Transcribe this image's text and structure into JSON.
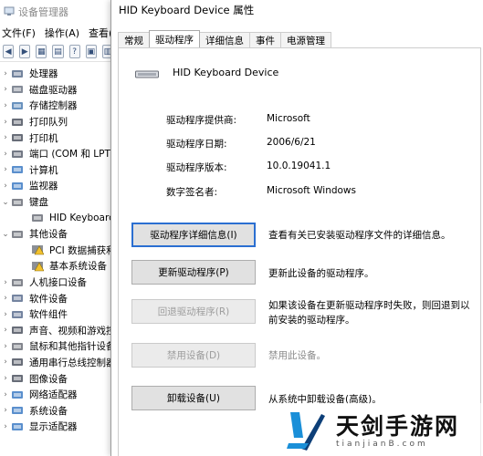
{
  "device_manager": {
    "title": "设备管理器",
    "menu": [
      "文件(F)",
      "操作(A)",
      "查看(V)"
    ],
    "tree": [
      {
        "chevron": "›",
        "icon": "cpu-icon",
        "label": "处理器"
      },
      {
        "chevron": "›",
        "icon": "disk-drive-icon",
        "label": "磁盘驱动器"
      },
      {
        "chevron": "›",
        "icon": "storage-controller-icon",
        "label": "存储控制器"
      },
      {
        "chevron": "›",
        "icon": "printer-icon",
        "label": "打印队列"
      },
      {
        "chevron": "›",
        "icon": "printer-icon",
        "label": "打印机"
      },
      {
        "chevron": "›",
        "icon": "port-icon",
        "label": "端口 (COM 和 LPT)"
      },
      {
        "chevron": "›",
        "icon": "computer-icon",
        "label": "计算机"
      },
      {
        "chevron": "›",
        "icon": "monitor-icon",
        "label": "监视器"
      },
      {
        "chevron": "⌄",
        "icon": "keyboard-icon",
        "label": "键盘"
      },
      {
        "chevron": "",
        "icon": "keyboard-icon",
        "label": "HID Keyboard Device",
        "indent": 2
      },
      {
        "chevron": "⌄",
        "icon": "unknown-device-icon",
        "label": "其他设备"
      },
      {
        "chevron": "",
        "icon": "warning-device-icon",
        "label": "PCI 数据捕获和信号处理控制器",
        "indent": 2
      },
      {
        "chevron": "",
        "icon": "warning-device-icon",
        "label": "基本系统设备",
        "indent": 2
      },
      {
        "chevron": "›",
        "icon": "hid-icon",
        "label": "人机接口设备"
      },
      {
        "chevron": "›",
        "icon": "software-device-icon",
        "label": "软件设备"
      },
      {
        "chevron": "›",
        "icon": "software-component-icon",
        "label": "软件组件"
      },
      {
        "chevron": "›",
        "icon": "audio-icon",
        "label": "声音、视频和游戏控制器"
      },
      {
        "chevron": "›",
        "icon": "mouse-icon",
        "label": "鼠标和其他指针设备"
      },
      {
        "chevron": "›",
        "icon": "usb-icon",
        "label": "通用串行总线控制器"
      },
      {
        "chevron": "›",
        "icon": "imaging-icon",
        "label": "图像设备"
      },
      {
        "chevron": "›",
        "icon": "network-icon",
        "label": "网络适配器"
      },
      {
        "chevron": "›",
        "icon": "system-icon",
        "label": "系统设备"
      },
      {
        "chevron": "›",
        "icon": "display-adapter-icon",
        "label": "显示适配器"
      }
    ]
  },
  "dialog": {
    "title": "HID Keyboard Device 属性",
    "tabs": [
      "常规",
      "驱动程序",
      "详细信息",
      "事件",
      "电源管理"
    ],
    "active_tab": "驱动程序",
    "device_name": "HID Keyboard Device",
    "info": [
      {
        "label": "驱动程序提供商:",
        "value": "Microsoft"
      },
      {
        "label": "驱动程序日期:",
        "value": "2006/6/21"
      },
      {
        "label": "驱动程序版本:",
        "value": "10.0.19041.1"
      },
      {
        "label": "数字签名者:",
        "value": "Microsoft Windows"
      }
    ],
    "actions": [
      {
        "button": "驱动程序详细信息(I)",
        "desc": "查看有关已安装驱动程序文件的详细信息。",
        "enabled": true,
        "default": true
      },
      {
        "button": "更新驱动程序(P)",
        "desc": "更新此设备的驱动程序。",
        "enabled": true
      },
      {
        "button": "回退驱动程序(R)",
        "desc": "如果该设备在更新驱动程序时失败，则回退到以前安装的驱动程序。",
        "enabled": false
      },
      {
        "button": "禁用设备(D)",
        "desc": "禁用此设备。",
        "enabled": false
      },
      {
        "button": "卸载设备(U)",
        "desc": "从系统中卸载设备(高级)。",
        "enabled": true
      }
    ]
  },
  "watermark": {
    "text": "天剑手游网",
    "sub": "tianjianB.com"
  }
}
